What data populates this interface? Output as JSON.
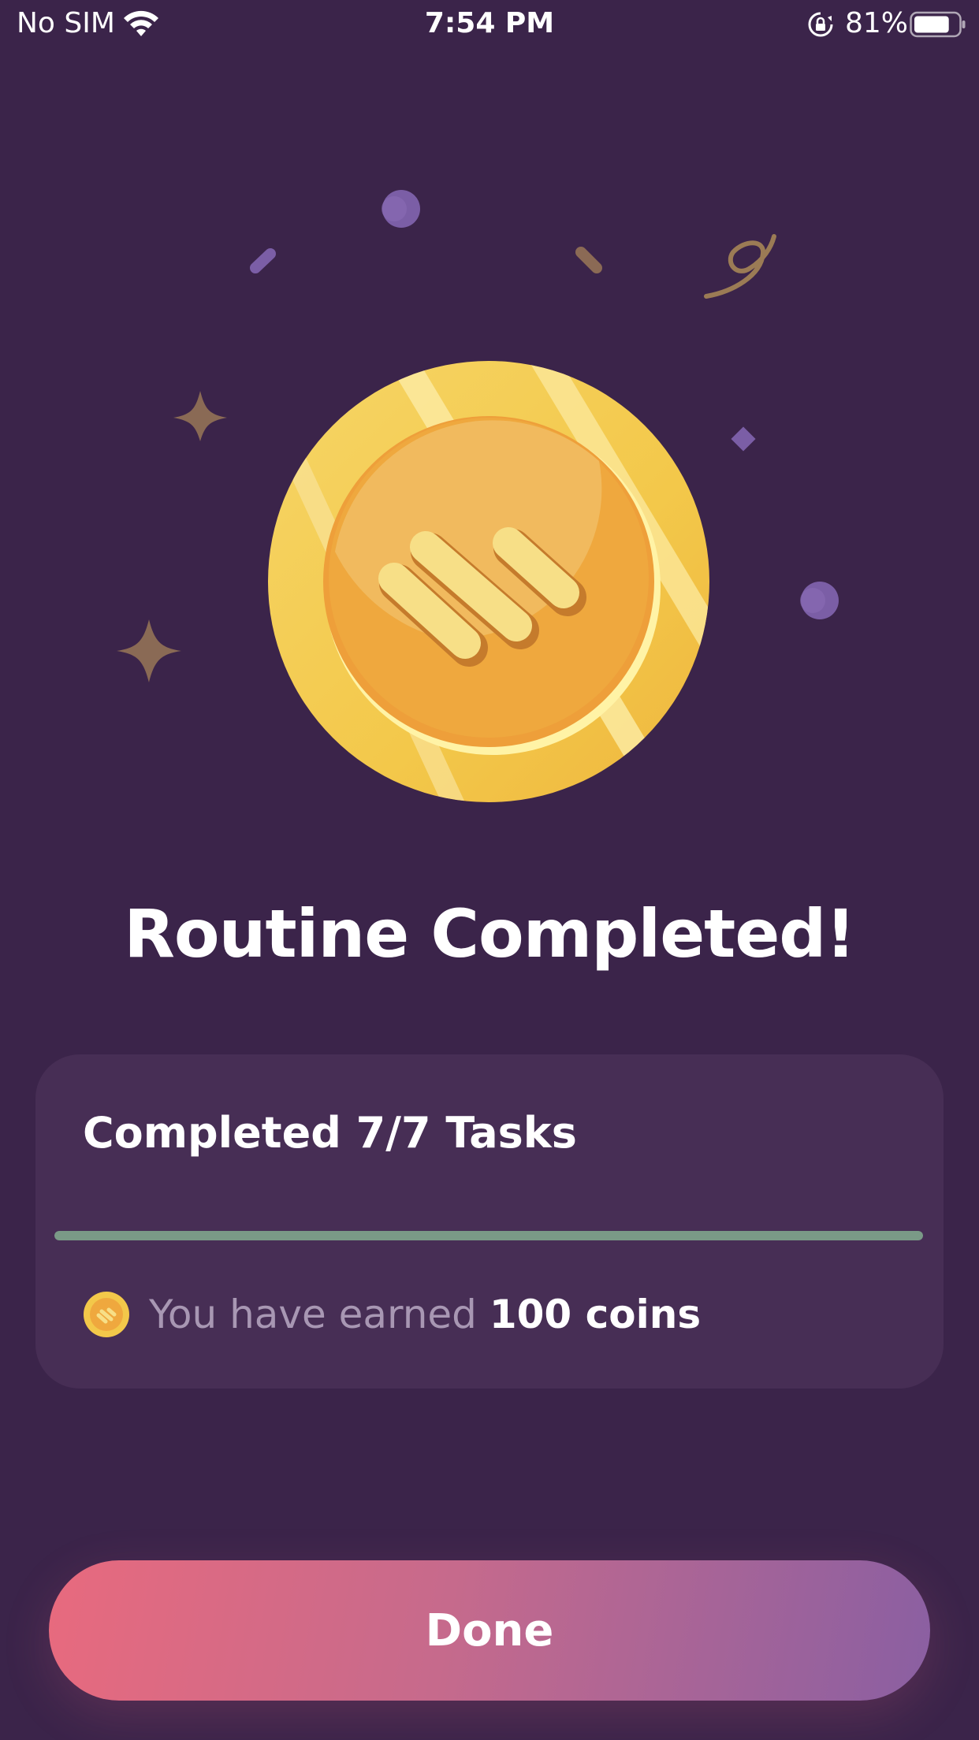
{
  "status_bar": {
    "carrier": "No SIM",
    "time": "7:54 PM",
    "battery_percent": "81%",
    "battery_level": 0.81,
    "icons": [
      "wifi-icon",
      "orientation-lock-icon",
      "battery-icon"
    ]
  },
  "hero": {
    "icon": "coin-icon"
  },
  "title": "Routine Completed!",
  "summary": {
    "tasks_label": "Completed 7/7 Tasks",
    "tasks_completed": 7,
    "tasks_total": 7,
    "progress": 1.0,
    "earned_prefix": "You have earned",
    "earned_amount": "100 coins",
    "coin_icon": "coin-icon"
  },
  "done_button": {
    "label": "Done"
  },
  "colors": {
    "background": "#3b244a",
    "card": "#472e55",
    "progress_fill": "#7a9a87",
    "button_start": "#e86a7e",
    "button_end": "#8a5fa2",
    "coin_gold": "#f3c84a"
  }
}
